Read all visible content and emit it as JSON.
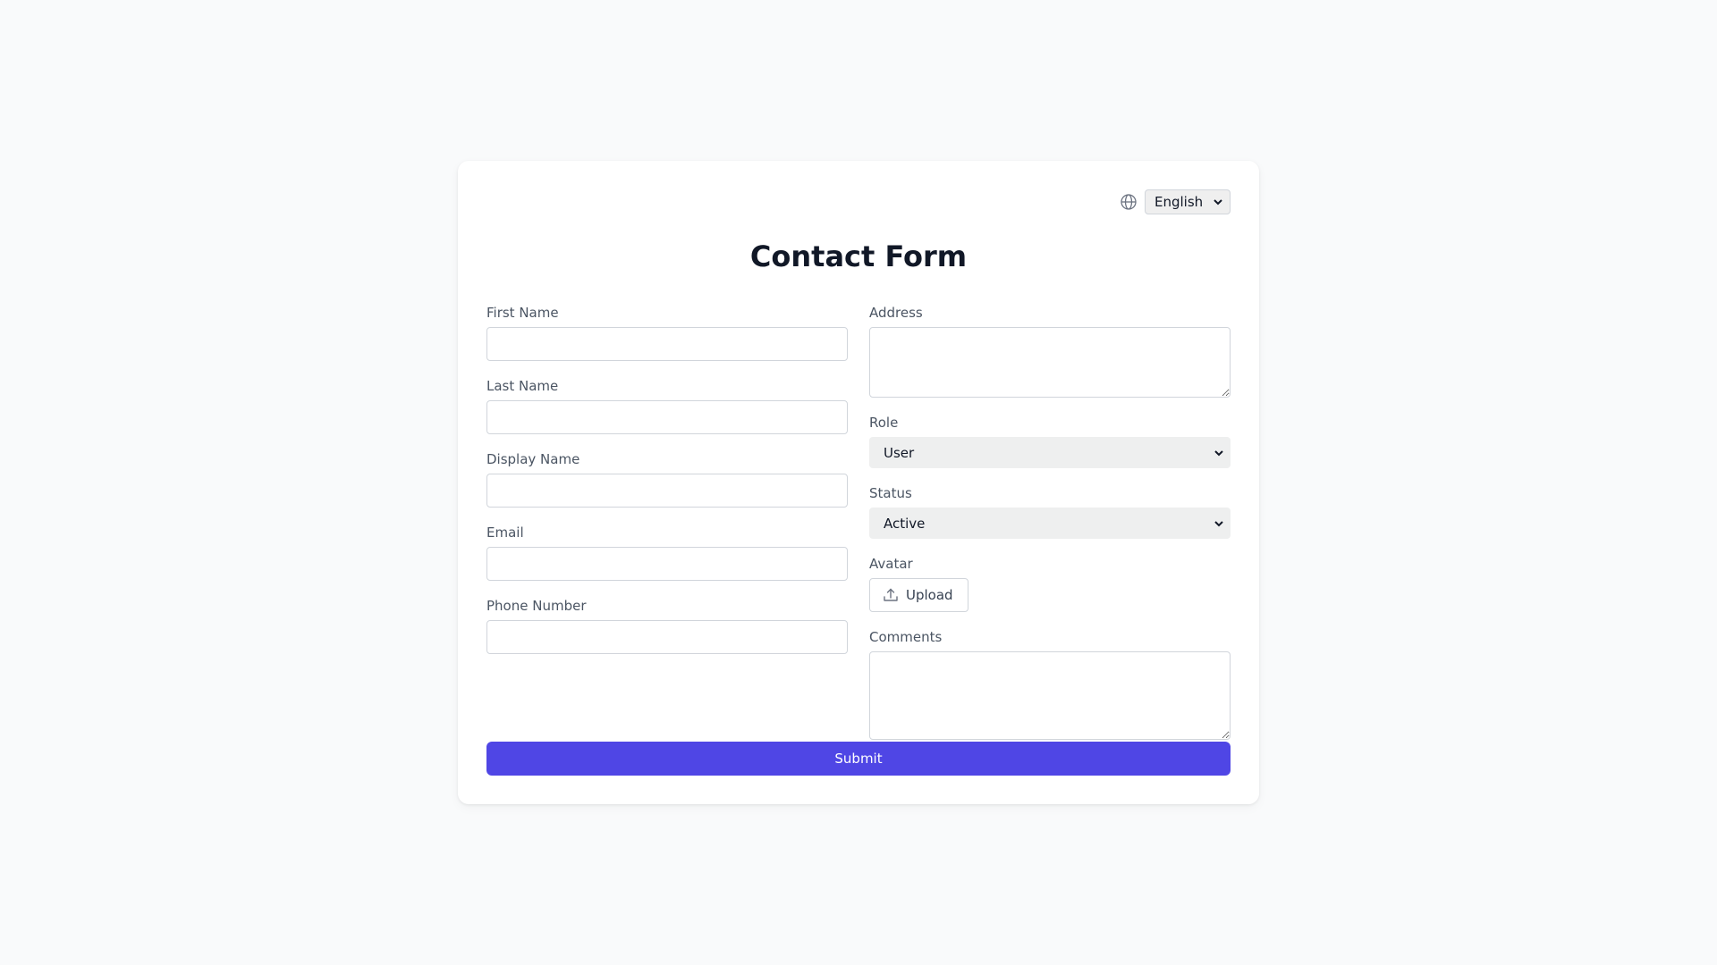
{
  "language": {
    "selected": "English",
    "icon": "globe-icon"
  },
  "form": {
    "title": "Contact Form",
    "left_fields": [
      {
        "label": "First Name",
        "value": ""
      },
      {
        "label": "Last Name",
        "value": ""
      },
      {
        "label": "Display Name",
        "value": ""
      },
      {
        "label": "Email",
        "value": ""
      },
      {
        "label": "Phone Number",
        "value": ""
      }
    ],
    "address": {
      "label": "Address",
      "value": ""
    },
    "role": {
      "label": "Role",
      "selected": "User"
    },
    "status": {
      "label": "Status",
      "selected": "Active"
    },
    "avatar": {
      "label": "Avatar",
      "button_label": "Upload",
      "icon": "upload-icon"
    },
    "comments": {
      "label": "Comments",
      "value": ""
    },
    "submit_label": "Submit"
  },
  "colors": {
    "page_background": "#f9fafb",
    "card_background": "#ffffff",
    "primary": "#4f46e5",
    "label_text": "#4b5563",
    "border": "#d1d5db"
  }
}
